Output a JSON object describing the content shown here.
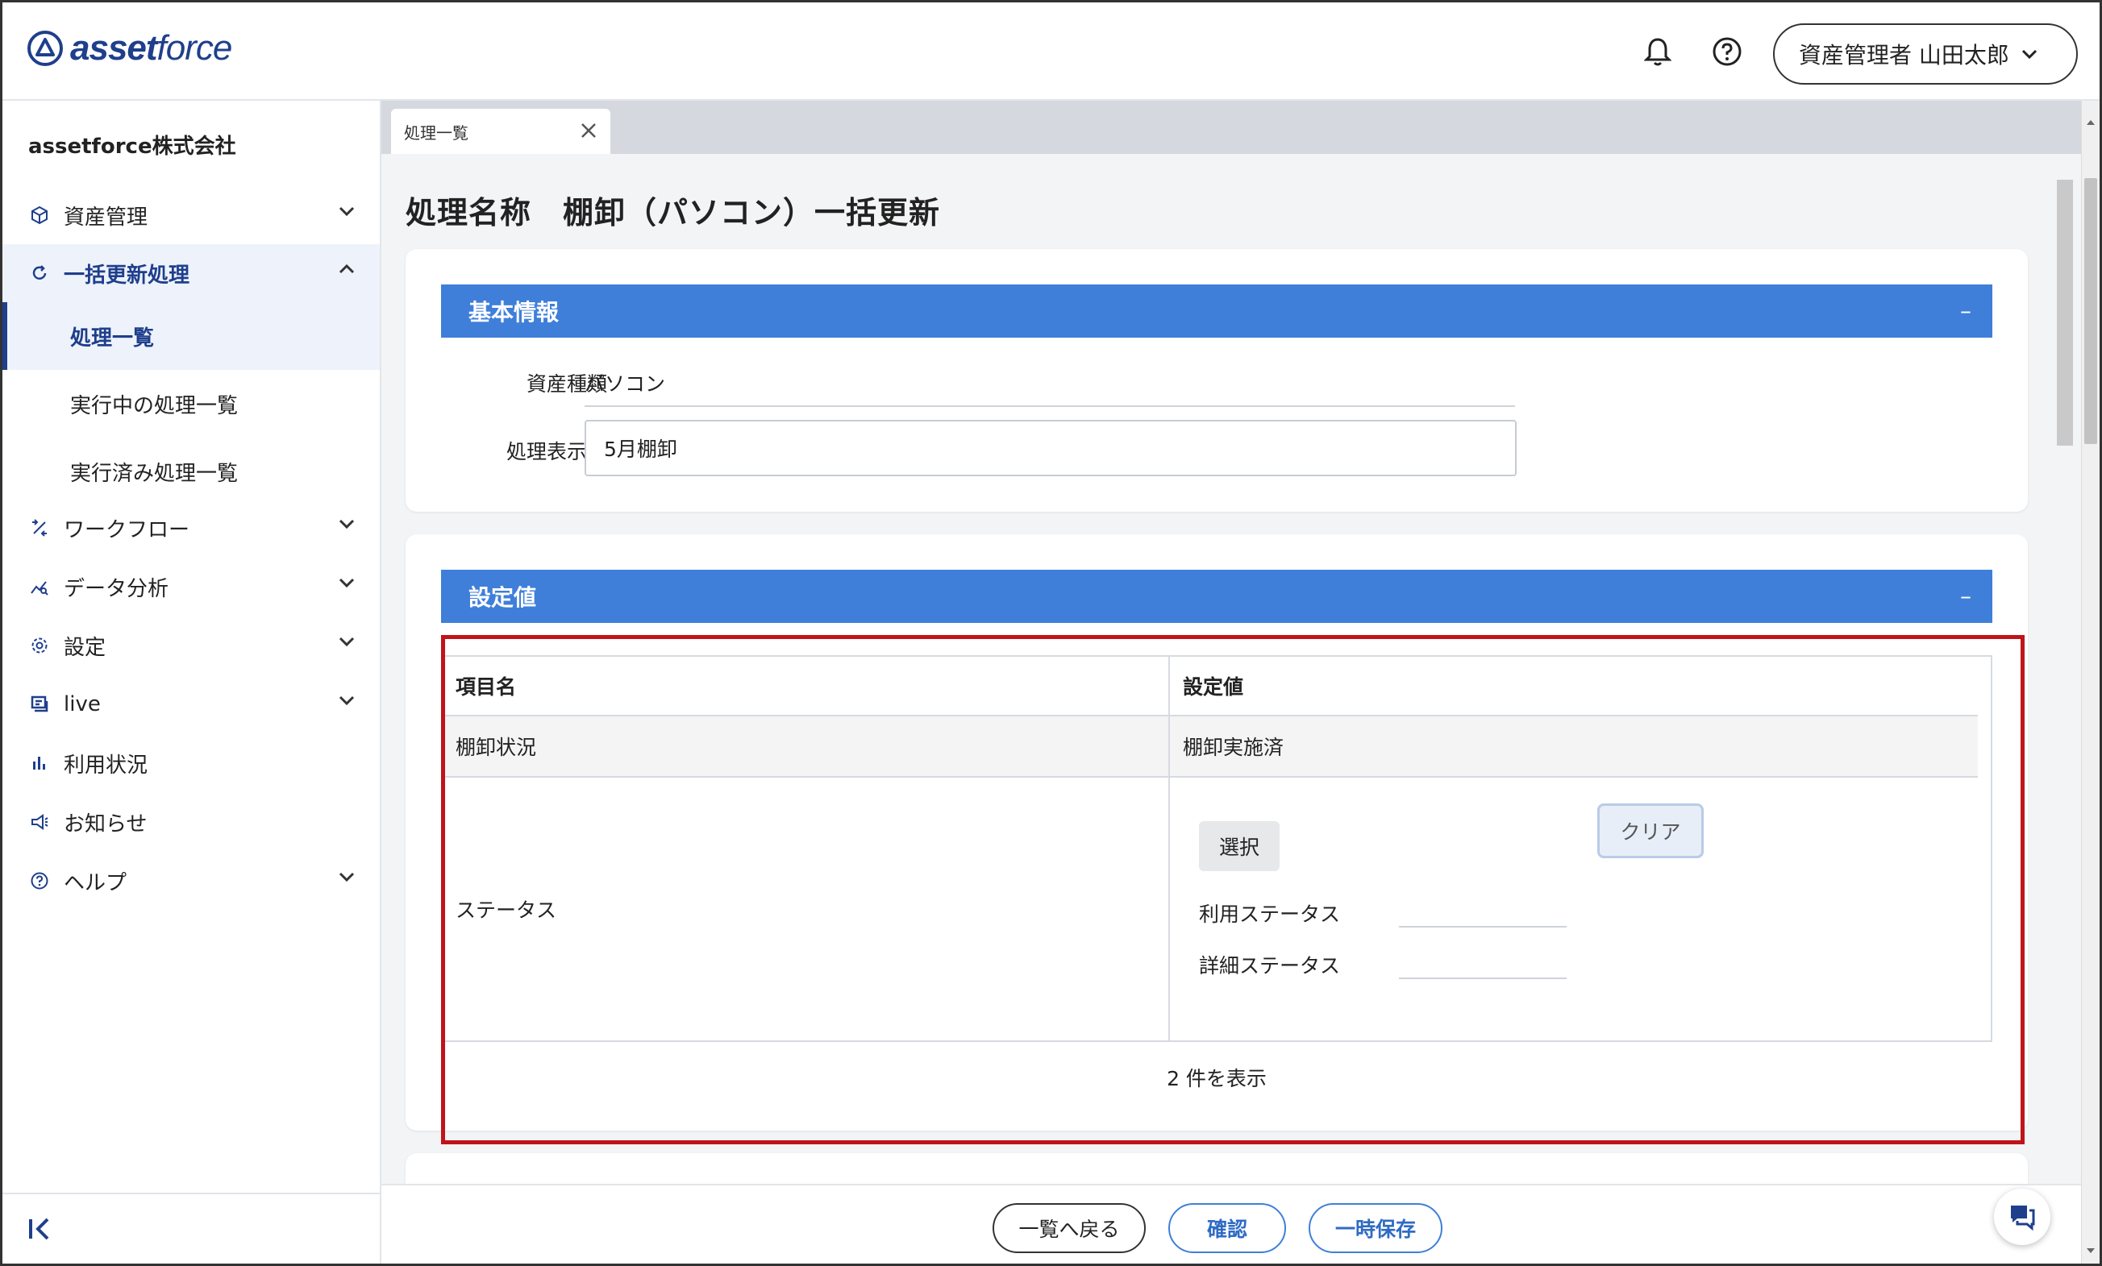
{
  "header": {
    "logo_bold": "asset",
    "logo_light": "force",
    "user_label": "資産管理者 山田太郎"
  },
  "sidebar": {
    "company": "assetforce株式会社",
    "items": [
      {
        "label": "資産管理",
        "icon": "cube-icon"
      },
      {
        "label": "一括更新処理",
        "icon": "refresh-icon"
      },
      {
        "label": "ワークフロー",
        "icon": "workflow-icon"
      },
      {
        "label": "データ分析",
        "icon": "analytics-icon"
      },
      {
        "label": "設定",
        "icon": "gear-icon"
      },
      {
        "label": "live",
        "icon": "live-icon"
      },
      {
        "label": "利用状況",
        "icon": "bar-chart-icon"
      },
      {
        "label": "お知らせ",
        "icon": "megaphone-icon"
      },
      {
        "label": "ヘルプ",
        "icon": "help-circle-icon"
      }
    ],
    "sub_items": [
      {
        "label": "処理一覧"
      },
      {
        "label": "実行中の処理一覧"
      },
      {
        "label": "実行済み処理一覧"
      }
    ]
  },
  "tabs": [
    {
      "label": "処理一覧"
    }
  ],
  "page": {
    "title": "処理名称　棚卸（パソコン）一括更新"
  },
  "basic_info": {
    "heading": "基本情報",
    "collapse_symbol": "–",
    "asset_type_label": "資産種類",
    "asset_type_value": "パソコン",
    "display_name_label": "処理表示名",
    "display_name_value": "5月棚卸"
  },
  "settings": {
    "heading": "設定値",
    "collapse_symbol": "–",
    "columns": [
      "項目名",
      "設定値"
    ],
    "rows": [
      {
        "item": "棚卸状況",
        "value": "棚卸実施済"
      },
      {
        "item": "ステータス",
        "value": ""
      }
    ],
    "select_button": "選択",
    "clear_button": "クリア",
    "usage_status_label": "利用ステータス",
    "detail_status_label": "詳細ステータス",
    "count_text": "2 件を表示"
  },
  "footer": {
    "back_label": "一覧へ戻る",
    "confirm_label": "確認",
    "save_label": "一時保存"
  },
  "colors": {
    "brand": "#1f3f8c",
    "section_header": "#3f7fd9",
    "highlight": "#c0131b"
  }
}
